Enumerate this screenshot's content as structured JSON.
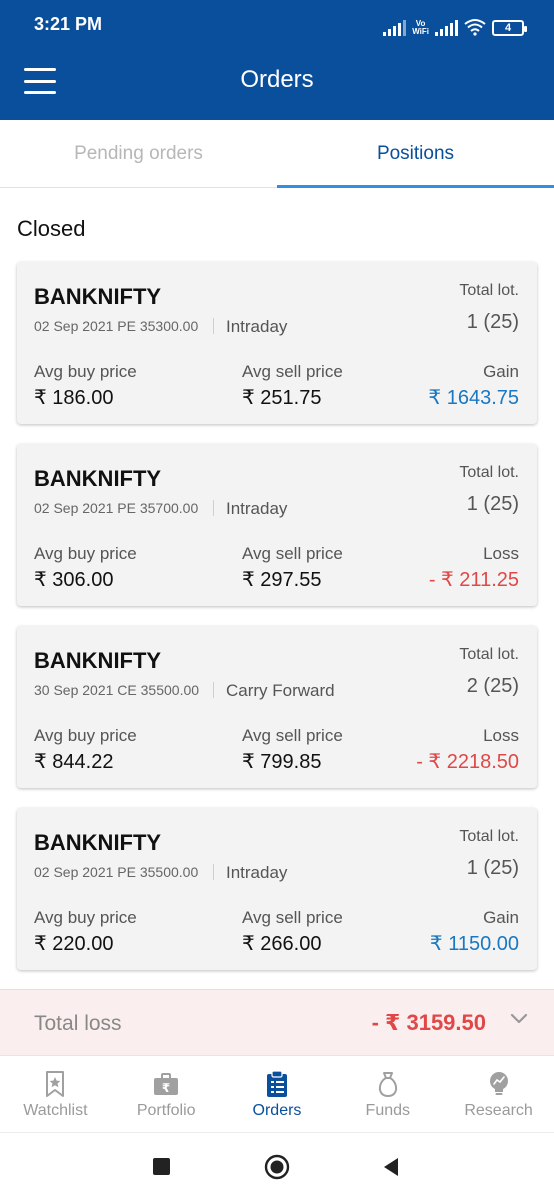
{
  "status_bar": {
    "time": "3:21 PM",
    "volte": "Vo WiFi",
    "battery": "4"
  },
  "app_bar": {
    "title": "Orders"
  },
  "tabs": [
    {
      "label": "Pending orders",
      "active": false
    },
    {
      "label": "Positions",
      "active": true
    }
  ],
  "section": {
    "title": "Closed"
  },
  "labels": {
    "total_lot": "Total lot.",
    "avg_buy": "Avg buy price",
    "avg_sell": "Avg sell price"
  },
  "positions": [
    {
      "symbol": "BANKNIFTY",
      "contract": "02 Sep 2021 PE 35300.00",
      "product": "Intraday",
      "lots": "1 (25)",
      "avg_buy": "₹ 186.00",
      "avg_sell": "₹ 251.75",
      "result_label": "Gain",
      "result_value": "₹ 1643.75",
      "result_type": "gain"
    },
    {
      "symbol": "BANKNIFTY",
      "contract": "02 Sep 2021 PE 35700.00",
      "product": "Intraday",
      "lots": "1 (25)",
      "avg_buy": "₹ 306.00",
      "avg_sell": "₹ 297.55",
      "result_label": "Loss",
      "result_value": "- ₹ 211.25",
      "result_type": "loss"
    },
    {
      "symbol": "BANKNIFTY",
      "contract": "30 Sep 2021 CE 35500.00",
      "product": "Carry Forward",
      "lots": "2 (25)",
      "avg_buy": "₹ 844.22",
      "avg_sell": "₹ 799.85",
      "result_label": "Loss",
      "result_value": "- ₹ 2218.50",
      "result_type": "loss"
    },
    {
      "symbol": "BANKNIFTY",
      "contract": "02 Sep 2021 PE 35500.00",
      "product": "Intraday",
      "lots": "1 (25)",
      "avg_buy": "₹ 220.00",
      "avg_sell": "₹ 266.00",
      "result_label": "Gain",
      "result_value": "₹ 1150.00",
      "result_type": "gain"
    }
  ],
  "total": {
    "label": "Total loss",
    "value": "- ₹ 3159.50"
  },
  "bottom_nav": [
    {
      "label": "Watchlist",
      "icon": "bookmark-icon",
      "active": false
    },
    {
      "label": "Portfolio",
      "icon": "briefcase-rupee-icon",
      "active": false
    },
    {
      "label": "Orders",
      "icon": "clipboard-list-icon",
      "active": true
    },
    {
      "label": "Funds",
      "icon": "money-bag-icon",
      "active": false
    },
    {
      "label": "Research",
      "icon": "lightbulb-icon",
      "active": false
    }
  ],
  "colors": {
    "primary": "#0a4f9c",
    "tab_indicator": "#2f8ee6",
    "gain": "#1a78c2",
    "loss": "#e04848",
    "total_bg": "#fbeeee"
  }
}
